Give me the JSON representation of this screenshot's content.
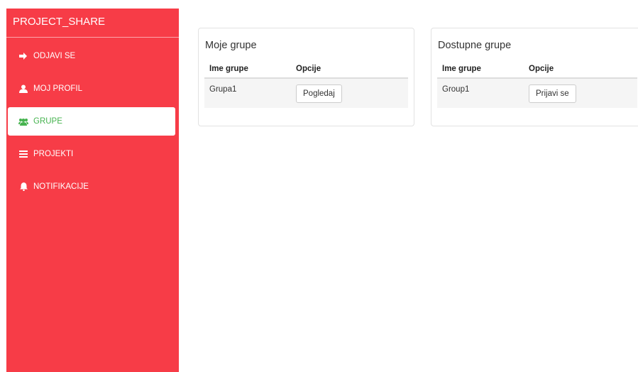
{
  "sidebar": {
    "brand": "PROJECT_SHARE",
    "items": [
      {
        "label": "ODJAVI SE",
        "icon": "logout-icon",
        "active": false
      },
      {
        "label": "MOJ PROFIL",
        "icon": "user-icon",
        "active": false
      },
      {
        "label": "GRUPE",
        "icon": "users-icon",
        "active": true
      },
      {
        "label": "PROJEKTI",
        "icon": "list-icon",
        "active": false
      },
      {
        "label": "NOTIFIKACIJE",
        "icon": "bell-icon",
        "active": false
      }
    ]
  },
  "my_groups": {
    "title": "Moje grupe",
    "columns": [
      "Ime grupe",
      "Opcije"
    ],
    "rows": [
      {
        "name": "Grupa1",
        "action": "Pogledaj"
      }
    ]
  },
  "available_groups": {
    "title": "Dostupne grupe",
    "columns": [
      "Ime grupe",
      "Opcije"
    ],
    "rows": [
      {
        "name": "Group1",
        "action": "Prijavi se"
      }
    ]
  },
  "colors": {
    "sidebar_bg": "#f73c47",
    "active_text": "#46b34f"
  }
}
